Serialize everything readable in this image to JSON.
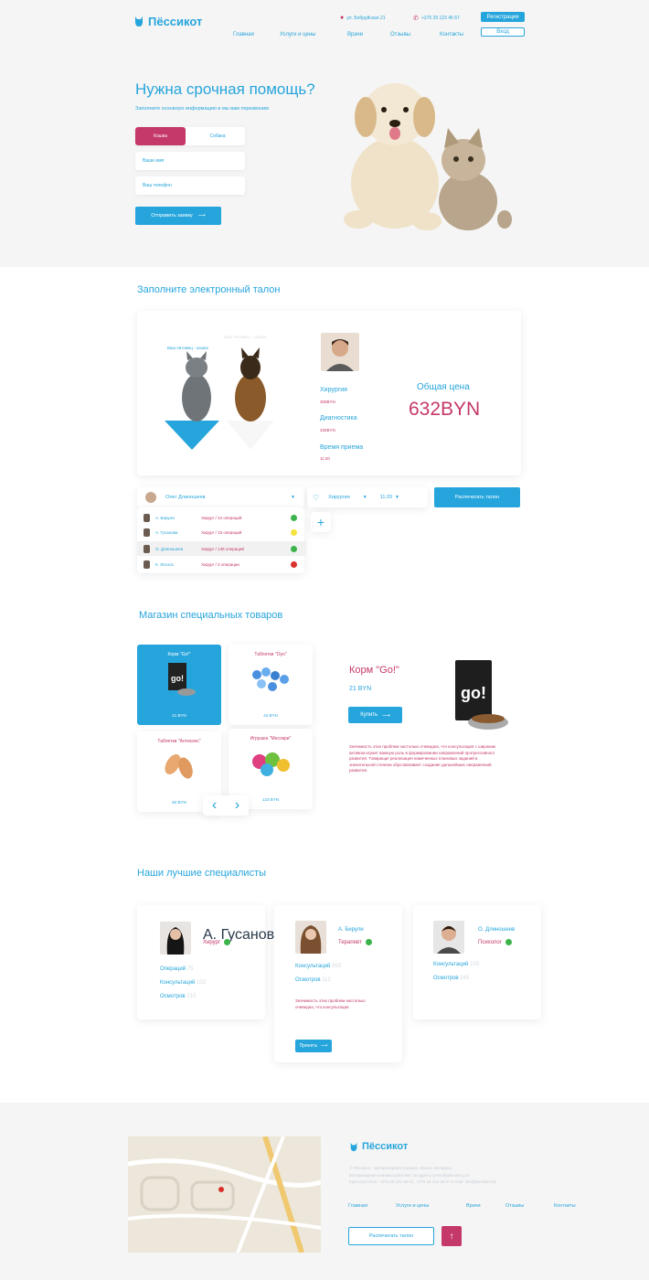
{
  "header": {
    "brand": "Пёссикот",
    "address": "ул. Бобруйская 21",
    "phone": "+375 29 123 45 67",
    "register_label": "Регистрация",
    "login_label": "Вход",
    "nav": [
      "Главная",
      "Услуги и цены",
      "Врачи",
      "Отзывы",
      "Контакты"
    ]
  },
  "hero": {
    "title": "Нужна срочная помощь?",
    "subtitle": "Заполните основную информацию и мы вам перезвоним",
    "toggle": [
      "Кошка",
      "Собака"
    ],
    "name_placeholder": "Ваше имя",
    "phone_placeholder": "Ваш телефон",
    "submit_label": "Отправить заявку"
  },
  "talon": {
    "title": "Заполните электронный талон",
    "pet_cat": "Ваш питомец - кошка",
    "pet_dog": "Ваш питомец - собака",
    "services": [
      {
        "name": "Хирургия",
        "price": "300BYN"
      },
      {
        "name": "Диагностика",
        "price": "332BYN"
      },
      {
        "name": "Время приема",
        "price": "11:20"
      }
    ],
    "total_label": "Общая цена",
    "total_value": "632BYN",
    "doctor_select": "Олег Длиношеев",
    "service_select": "Хирургия",
    "time_select": "11:20",
    "print_label": "Распечатать талон",
    "plus": "+",
    "doctors": [
      {
        "name": "А. Бирули",
        "info": "Хирург / 34 операций",
        "status": "#3cb44b"
      },
      {
        "name": "А. Гусанова",
        "info": "Хирург / 15 операций",
        "status": "#f5e23c"
      },
      {
        "name": "О. Длиношеев",
        "info": "Хирург / 138 операций",
        "status": "#3cb44b"
      },
      {
        "name": "К. Лесопс",
        "info": "Хирург / 3 операции",
        "status": "#d9312b"
      }
    ]
  },
  "shop": {
    "title": "Магазин специальных товаров",
    "products": [
      {
        "name": "Корм \"Go!\"",
        "price": "21 BYN"
      },
      {
        "name": "Таблетки \"Оун\"",
        "price": "44 BYN"
      },
      {
        "name": "Таблетки \"Антисекс\"",
        "price": "82 BYN"
      },
      {
        "name": "Игрушка \"Месокри\"",
        "price": "123 BYN"
      }
    ],
    "detail_name": "Корм \"Go!\"",
    "detail_price": "21 BYN",
    "buy_label": "Купить",
    "description": "Значимость этих проблем настолько очевидна, что консультация с широким активом играет важную роль в формировании направлений прогрессивного развития. Товарищи! реализация намеченных плановых заданий в значительной степени обуславливает создание дальнейших направлений развития.",
    "prev": "‹",
    "next": "›"
  },
  "specialists": {
    "title": "Наши лучшие специалисты",
    "cards": [
      {
        "name": "А. Гусанова",
        "role": "Хирург",
        "stats": [
          [
            "Операций",
            "75"
          ],
          [
            "Консультаций",
            "102"
          ],
          [
            "Осмотров",
            "210"
          ]
        ]
      },
      {
        "name": "А. Бирули",
        "role": "Терапевт",
        "stats": [
          [
            "Консультаций",
            "350"
          ],
          [
            "Осмотров",
            "112"
          ]
        ],
        "note": "Значимость этих проблем настолько очевидна, что консультация.",
        "button": "Принять"
      },
      {
        "name": "О. Длиношеев",
        "role": "Психолог",
        "stats": [
          [
            "Консультаций",
            "103"
          ],
          [
            "Осмотров",
            "245"
          ]
        ]
      }
    ]
  },
  "footer": {
    "brand": "Пёссикот",
    "lines": [
      "© Пёссикот - ветеринарная клиника. Минск, Беларусь",
      "Ветеринарная клиника работает по адресу ул.Бобруйская д.21",
      "Круглосуточно, +375 29 123 45 67, +375 44 123 45 67 e-mail: info@pessikot.by"
    ],
    "nav": [
      "Главная",
      "Услуги и цены",
      "Врачи",
      "Отзывы",
      "Контакты"
    ],
    "print_label": "Распечатать талон",
    "up_label": "↑"
  },
  "colors": {
    "accent": "#26a5dc",
    "pink": "#c4386a",
    "bg": "#f5f5f5"
  }
}
